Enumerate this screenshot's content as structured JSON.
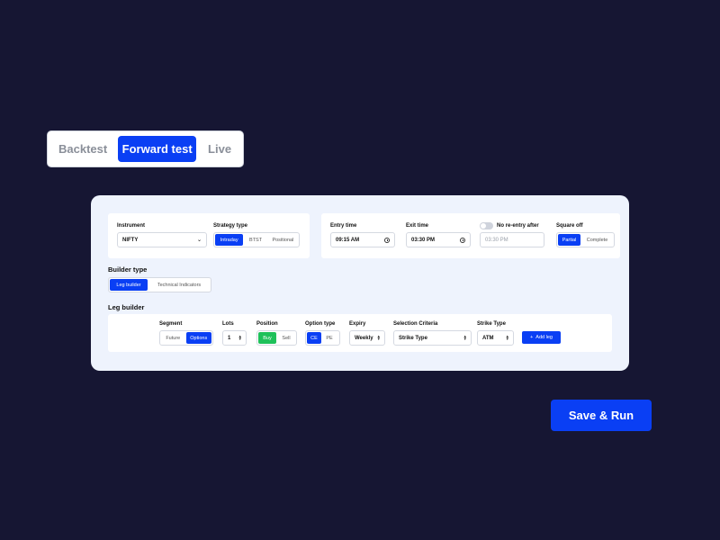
{
  "mode_tabs": [
    {
      "label": "Backtest",
      "active": false
    },
    {
      "label": "Forward test",
      "active": true
    },
    {
      "label": "Live",
      "active": false
    }
  ],
  "instrument": {
    "label": "Instrument",
    "value": "NIFTY"
  },
  "strategy_type": {
    "label": "Strategy type",
    "options": [
      "Intraday",
      "BTST",
      "Positional"
    ],
    "selected": "Intraday"
  },
  "entry_time": {
    "label": "Entry time",
    "value": "09:15 AM"
  },
  "exit_time": {
    "label": "Exit time",
    "value": "03:30 PM"
  },
  "no_reentry": {
    "label": "No re-entry after",
    "enabled": false,
    "placeholder": "03:30 PM"
  },
  "square_off": {
    "label": "Square off",
    "options": [
      "Partial",
      "Complete"
    ],
    "selected": "Partial"
  },
  "builder_type": {
    "label": "Builder type",
    "options": [
      "Leg builder",
      "Technical Indicators"
    ],
    "selected": "Leg builder"
  },
  "leg_builder": {
    "title": "Leg builder",
    "segment": {
      "label": "Segment",
      "options": [
        "Future",
        "Options"
      ],
      "selected": "Options"
    },
    "lots": {
      "label": "Lots",
      "value": "1"
    },
    "position": {
      "label": "Position",
      "options": [
        "Buy",
        "Sell"
      ],
      "selected": "Buy"
    },
    "option_type": {
      "label": "Option type",
      "options": [
        "CE",
        "PE"
      ],
      "selected": "CE"
    },
    "expiry": {
      "label": "Expiry",
      "value": "Weekly"
    },
    "selection_criteria": {
      "label": "Selection Criteria",
      "value": "Strike Type"
    },
    "strike_type": {
      "label": "Strike Type",
      "value": "ATM"
    },
    "add_leg_label": "Add leg"
  },
  "save_run_label": "Save & Run",
  "colors": {
    "background": "#161633",
    "accent": "#0a3ff4",
    "buy_green": "#1fc15a",
    "card": "#eef3fd"
  }
}
